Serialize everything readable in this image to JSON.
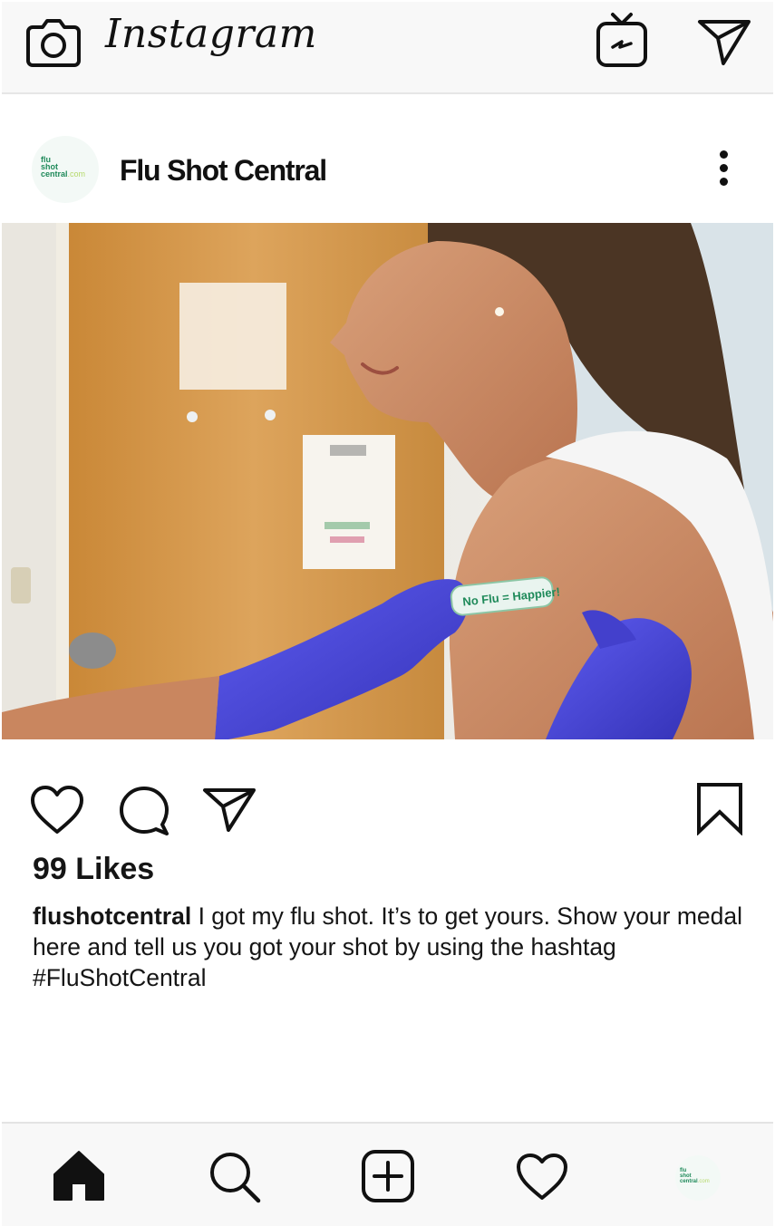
{
  "app": {
    "name": "Instagram"
  },
  "post": {
    "account_name": "Flu Shot Central",
    "avatar_text": {
      "line1": "flu",
      "line2": "shot",
      "line3": "central",
      "suffix": ".com"
    },
    "photo": {
      "bandage_text": "No Flu = Happier!"
    },
    "likes": "99 Likes",
    "caption": {
      "handle": "flushotcentral",
      "text": " I got my flu shot. It’s to get yours. Show your medal here and tell us you got your shot by using the hashtag #FluShotCentral"
    }
  },
  "icons": {
    "top": [
      "camera-icon",
      "igtv-icon",
      "direct-message-icon"
    ],
    "actions": [
      "like-heart-icon",
      "comment-icon",
      "share-icon",
      "bookmark-icon"
    ],
    "nav": [
      "home-icon",
      "search-icon",
      "add-post-icon",
      "activity-heart-icon",
      "profile-avatar"
    ]
  },
  "colors": {
    "bar_background": "#f8f8f8",
    "icon": "#111111",
    "glove": "#4a47d8",
    "brand_green": "#1f8a5a"
  }
}
